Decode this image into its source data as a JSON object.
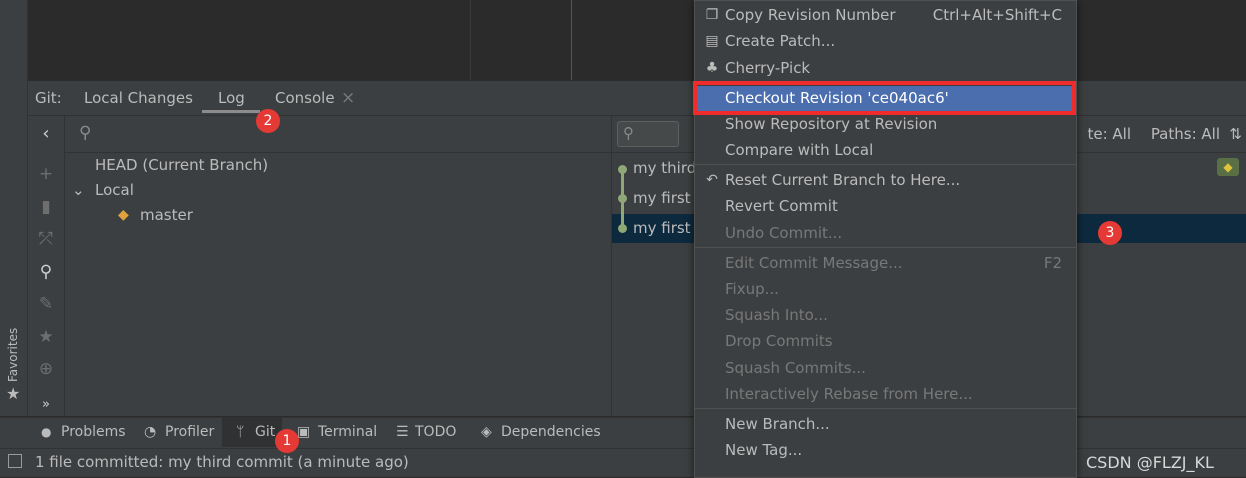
{
  "git_tabs": {
    "prefix": "Git:",
    "local_changes": "Local Changes",
    "log": "Log",
    "console": "Console",
    "close": "×"
  },
  "branches": {
    "head": "HEAD (Current Branch)",
    "local": "Local",
    "master": "master"
  },
  "commits": [
    {
      "msg": "my third"
    },
    {
      "msg": "my first c"
    },
    {
      "msg": "my first c"
    }
  ],
  "log_filters": {
    "date": "te: All",
    "paths": "Paths: All"
  },
  "menu": {
    "copy_revision": {
      "label": "Copy Revision Number",
      "shortcut": "Ctrl+Alt+Shift+C"
    },
    "create_patch": "Create Patch...",
    "cherry_pick": "Cherry-Pick",
    "checkout_revision": "Checkout Revision 'ce040ac6'",
    "show_repository": "Show Repository at Revision",
    "compare_local": "Compare with Local",
    "reset_branch": "Reset Current Branch to Here...",
    "revert_commit": "Revert Commit",
    "undo_commit": "Undo Commit...",
    "edit_message": {
      "label": "Edit Commit Message...",
      "shortcut": "F2"
    },
    "fixup": "Fixup...",
    "squash_into": "Squash Into...",
    "drop_commits": "Drop Commits",
    "squash_commits": "Squash Commits...",
    "interactive_rebase": "Interactively Rebase from Here...",
    "new_branch": "New Branch...",
    "new_tag": "New Tag..."
  },
  "bottom_tabs": {
    "problems": "Problems",
    "profiler": "Profiler",
    "git": "Git",
    "terminal": "Terminal",
    "todo": "TODO",
    "dependencies": "Dependencies"
  },
  "status": "1 file committed: my third commit (a minute ago)",
  "favorites": "Favorites",
  "watermark": "CSDN @FLZJ_KL",
  "badges": {
    "one": "1",
    "two": "2",
    "three": "3"
  },
  "colors": {
    "highlight": "#4b6eaf",
    "annotation": "#ef2b2b",
    "graph": "#8fa876"
  }
}
